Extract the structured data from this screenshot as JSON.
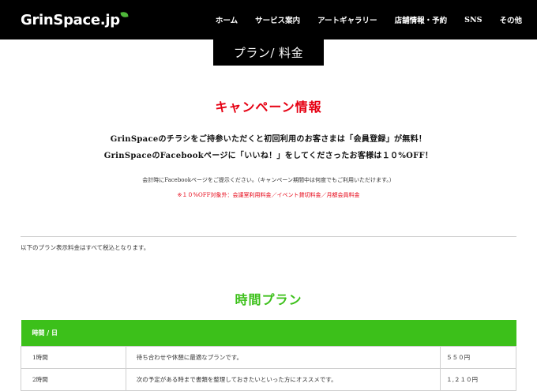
{
  "header": {
    "logo_text": "GrinSpace.jp",
    "nav": [
      "ホーム",
      "サービス案内",
      "アートギャラリー",
      "店舗情報・予約",
      "SNS",
      "その他"
    ]
  },
  "page_tab": "プラン/ 料金",
  "campaign": {
    "heading": "キャンペーン情報",
    "line1": "GrinSpaceのチラシをご持参いただくと初回利用のお客さまは「会員登録」が無料！",
    "line2": "GrinSpaceのFacebookページに「いいね！」をしてくださったお客様は１０%OFF！",
    "note": "会計時にFacebookページをご提示ください。（キャンペーン期間中は何度でもご利用いただけます。）",
    "exclusion": "※１０%OFF対象外：会議室利用料金／イベント貸切料金／月額会員料金"
  },
  "tax_note": "以下のプラン表示料金はすべて税込となります。",
  "time_plan": {
    "heading": "時間プラン",
    "table_header": "時間 / 日",
    "rows": [
      {
        "name": "1時間",
        "desc": "待ち合わせや休憩に最適なプランです。",
        "price": "５５０円"
      },
      {
        "name": "2時間",
        "desc": "次の予定がある時まで書類を整理しておきたいといった方にオススメです。",
        "price": "１,２１０円"
      }
    ]
  },
  "colors": {
    "header_bg": "#000000",
    "campaign_red": "#e60012",
    "plan_green": "#3cc01a",
    "logo_leaf": "#4fb83a"
  }
}
